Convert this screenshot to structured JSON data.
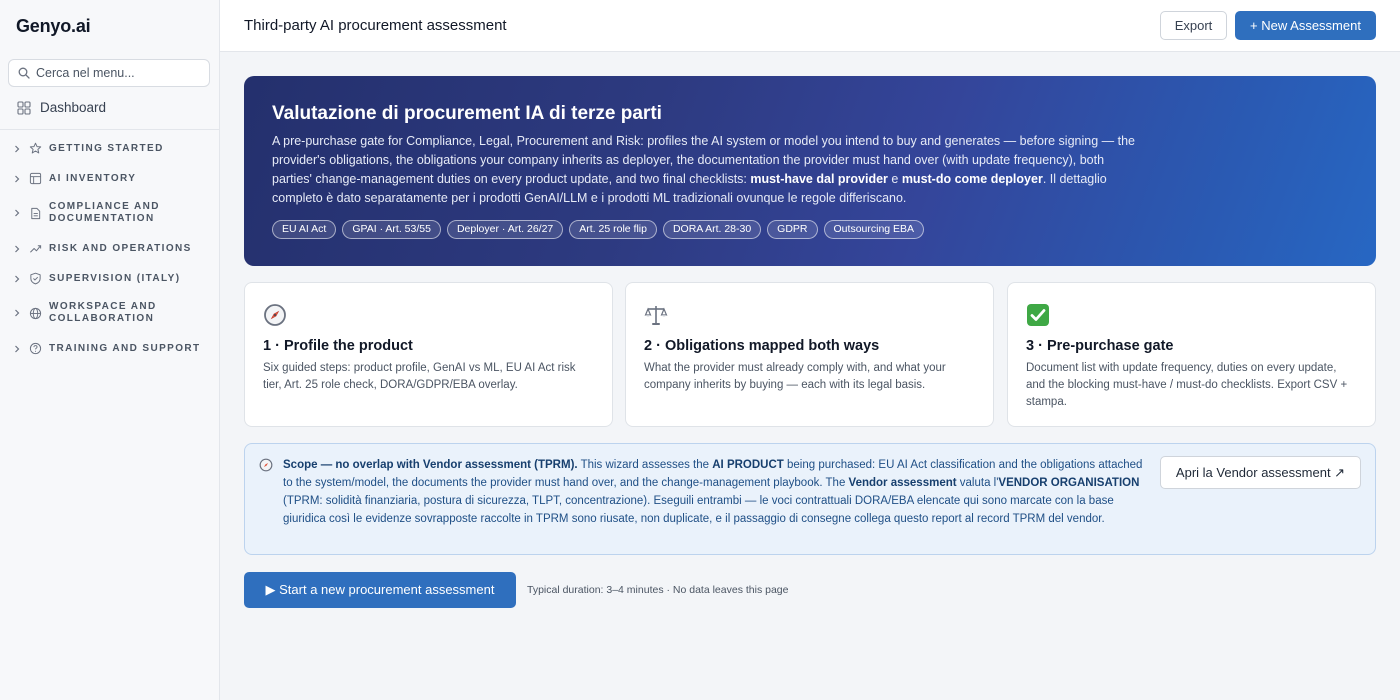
{
  "sidebar": {
    "brand": "Genyo.ai",
    "search_placeholder": "Cerca nel menu...",
    "dashboard_label": "Dashboard",
    "groups": [
      {
        "label": "GETTING STARTED",
        "icon": "star-icon"
      },
      {
        "label": "AI INVENTORY",
        "icon": "table-icon"
      },
      {
        "label": "COMPLIANCE AND DOCUMENTATION",
        "icon": "document-icon"
      },
      {
        "label": "RISK AND OPERATIONS",
        "icon": "trend-icon"
      },
      {
        "label": "SUPERVISION (ITALY)",
        "icon": "shield-icon"
      },
      {
        "label": "WORKSPACE AND COLLABORATION",
        "icon": "globe-icon"
      },
      {
        "label": "TRAINING AND SUPPORT",
        "icon": "help-icon"
      }
    ]
  },
  "header": {
    "title": "Third-party AI procurement assessment",
    "export_label": "Export",
    "new_label": "+ New Assessment"
  },
  "hero": {
    "title": "Valutazione di procurement IA di terze parti",
    "text_1": "A pre-purchase gate for Compliance, Legal, Procurement and Risk: profiles the AI system or model you intend to buy and generates — before signing — the provider's obligations, the obligations your company inherits as deployer, the documentation the provider must hand over (with update frequency), both parties' change-management duties on every product update, and two final checklists: ",
    "bold_1": "must-have dal provider",
    "text_2": " e ",
    "bold_2": "must-do come deployer",
    "text_3": ". Il dettaglio completo è dato separatamente per i prodotti GenAI/LLM e i prodotti ML tradizionali ovunque le regole differiscano.",
    "tags": [
      "EU AI Act",
      "GPAI · Art. 53/55",
      "Deployer · Art. 26/27",
      "Art. 25 role flip",
      "DORA Art. 28-30",
      "GDPR",
      "Outsourcing EBA"
    ]
  },
  "cards": [
    {
      "icon": "compass-icon",
      "title": "1 · Profile the product",
      "text": "Six guided steps: product profile, GenAI vs ML, EU AI Act risk tier, Art. 25 role check, DORA/GDPR/EBA overlay."
    },
    {
      "icon": "scales-icon",
      "title": "2 · Obligations mapped both ways",
      "text": "What the provider must already comply with, and what your company inherits by buying — each with its legal basis."
    },
    {
      "icon": "check-icon",
      "title": "3 · Pre-purchase gate",
      "text": "Document list with update frequency, duties on every update, and the blocking must-have / must-do checklists. Export CSV + stampa."
    }
  ],
  "scope": {
    "bold_1": "Scope — no overlap with Vendor assessment (TPRM).",
    "text_1": " This wizard assesses the ",
    "bold_2": "AI PRODUCT",
    "text_2": " being purchased: EU AI Act classification and the obligations attached to the system/model, the documents the provider must hand over, and the change-management playbook. The ",
    "bold_3": "Vendor assessment",
    "text_3": " valuta l'",
    "bold_4": "VENDOR ORGANISATION",
    "text_4": " (TPRM: solidità finanziaria, postura di sicurezza, TLPT, concentrazione). Eseguili entrambi — le voci contrattuali DORA/EBA elencate qui sono marcate con la base giuridica così le evidenze sovrapposte raccolte in TPRM sono riusate, non duplicate, e il passaggio di consegne collega questo report al record TPRM del vendor.",
    "vendor_button": "Apri la Vendor assessment ↗"
  },
  "start": {
    "button_label": "▶ Start a new procurement assessment",
    "duration": "Typical duration: 3–4 minutes · No data leaves this page"
  },
  "colors": {
    "accent": "#2f6fbe",
    "hero_start": "#24306d",
    "hero_end": "#2767c3",
    "scope_bg": "#eaf2fb"
  }
}
